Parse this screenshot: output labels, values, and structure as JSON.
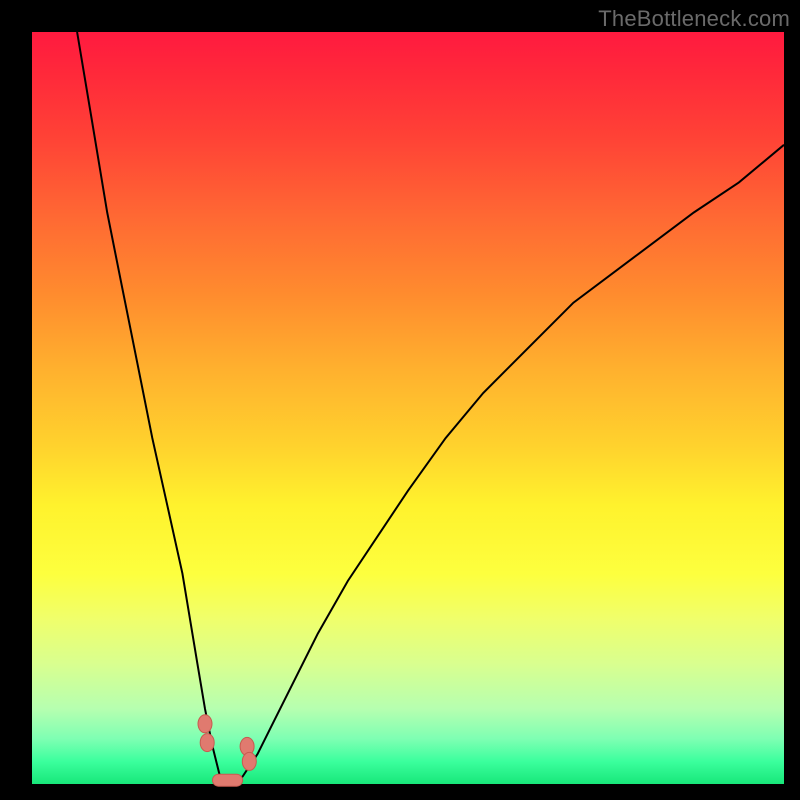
{
  "watermark": "TheBottleneck.com",
  "colors": {
    "background": "#000000",
    "curve": "#000000",
    "marker": "#e07a6f",
    "gradient_top": "#ff1a3f",
    "gradient_bottom": "#18e77a"
  },
  "chart_data": {
    "type": "line",
    "title": "",
    "xlabel": "",
    "ylabel": "",
    "xlim": [
      0,
      100
    ],
    "ylim": [
      0,
      100
    ],
    "note": "Bottleneck-percentage style V-curve. Minimum (≈0) near x≈25; left branch rises steeply to ~100 at x≈6; right branch rises with diminishing slope toward ~85 at x=100. Values estimated from pixels.",
    "series": [
      {
        "name": "curve",
        "x": [
          6,
          8,
          10,
          12,
          14,
          16,
          18,
          20,
          22,
          23,
          24,
          25,
          26,
          27,
          28,
          30,
          32,
          35,
          38,
          42,
          46,
          50,
          55,
          60,
          66,
          72,
          80,
          88,
          94,
          100
        ],
        "y": [
          100,
          88,
          76,
          66,
          56,
          46,
          37,
          28,
          16,
          10,
          5,
          1,
          0,
          0,
          1,
          4,
          8,
          14,
          20,
          27,
          33,
          39,
          46,
          52,
          58,
          64,
          70,
          76,
          80,
          85
        ]
      }
    ],
    "markers": [
      {
        "x": 23.0,
        "y": 8.0
      },
      {
        "x": 23.3,
        "y": 5.5
      },
      {
        "x": 28.6,
        "y": 5.0
      },
      {
        "x": 28.9,
        "y": 3.0
      }
    ],
    "bottom_bar": {
      "x_start": 24.0,
      "x_end": 28.0,
      "y": 0.5
    }
  }
}
